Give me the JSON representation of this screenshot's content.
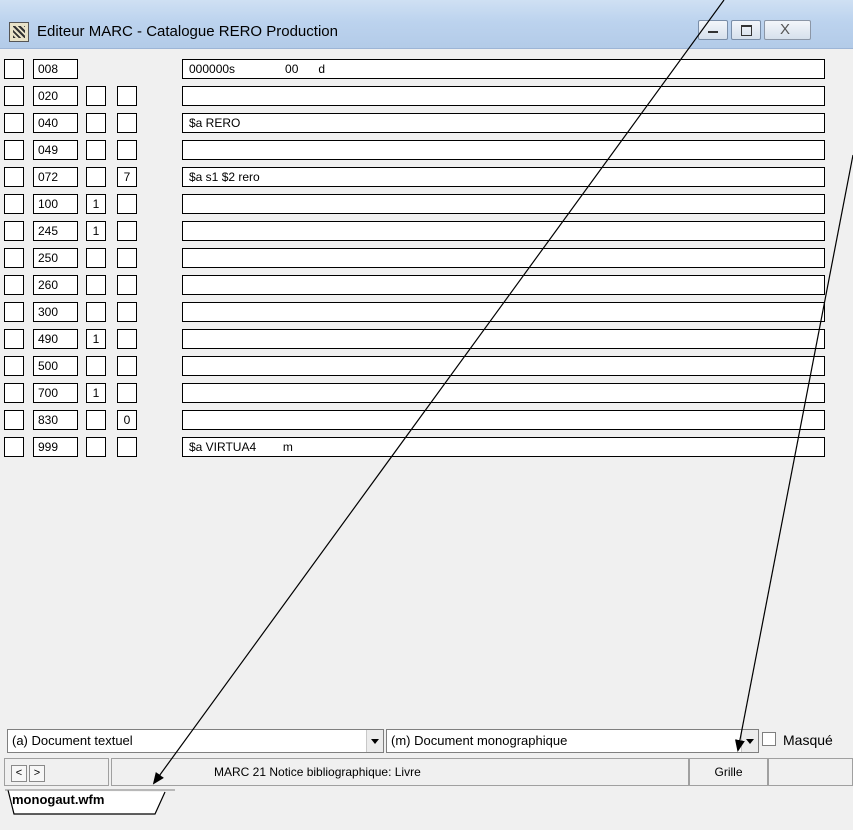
{
  "window": {
    "title": "Editeur MARC - Catalogue RERO Production",
    "icon": "marc-editor-icon",
    "minimize_glyph": "",
    "maximize_glyph": "",
    "close_glyph": "X"
  },
  "fields": [
    {
      "tag": "008",
      "ind1": null,
      "ind2": null,
      "value": "000000s               00      d"
    },
    {
      "tag": "020",
      "ind1": "",
      "ind2": "",
      "value": ""
    },
    {
      "tag": "040",
      "ind1": "",
      "ind2": "",
      "value": "$a RERO"
    },
    {
      "tag": "049",
      "ind1": "",
      "ind2": "",
      "value": ""
    },
    {
      "tag": "072",
      "ind1": "",
      "ind2": "7",
      "value": "$a s1 $2 rero"
    },
    {
      "tag": "100",
      "ind1": "1",
      "ind2": "",
      "value": ""
    },
    {
      "tag": "245",
      "ind1": "1",
      "ind2": "",
      "value": ""
    },
    {
      "tag": "250",
      "ind1": "",
      "ind2": "",
      "value": ""
    },
    {
      "tag": "260",
      "ind1": "",
      "ind2": "",
      "value": ""
    },
    {
      "tag": "300",
      "ind1": "",
      "ind2": "",
      "value": ""
    },
    {
      "tag": "490",
      "ind1": "1",
      "ind2": "",
      "value": ""
    },
    {
      "tag": "500",
      "ind1": "",
      "ind2": "",
      "value": ""
    },
    {
      "tag": "700",
      "ind1": "1",
      "ind2": "",
      "value": ""
    },
    {
      "tag": "830",
      "ind1": "",
      "ind2": "0",
      "value": ""
    },
    {
      "tag": "999",
      "ind1": "",
      "ind2": "",
      "value": "$a VIRTUA4        m"
    }
  ],
  "bottom": {
    "doc_type": "(a) Document textuel",
    "biblio_level": "(m) Document monographique",
    "masque_label": "Masqué",
    "masque_checked": false
  },
  "status": {
    "prev": "<",
    "next": ">",
    "record_type": "MARC 21 Notice bibliographique: Livre",
    "view_mode": "Grille"
  },
  "tabs": [
    {
      "label": "monogaut.wfm"
    }
  ]
}
